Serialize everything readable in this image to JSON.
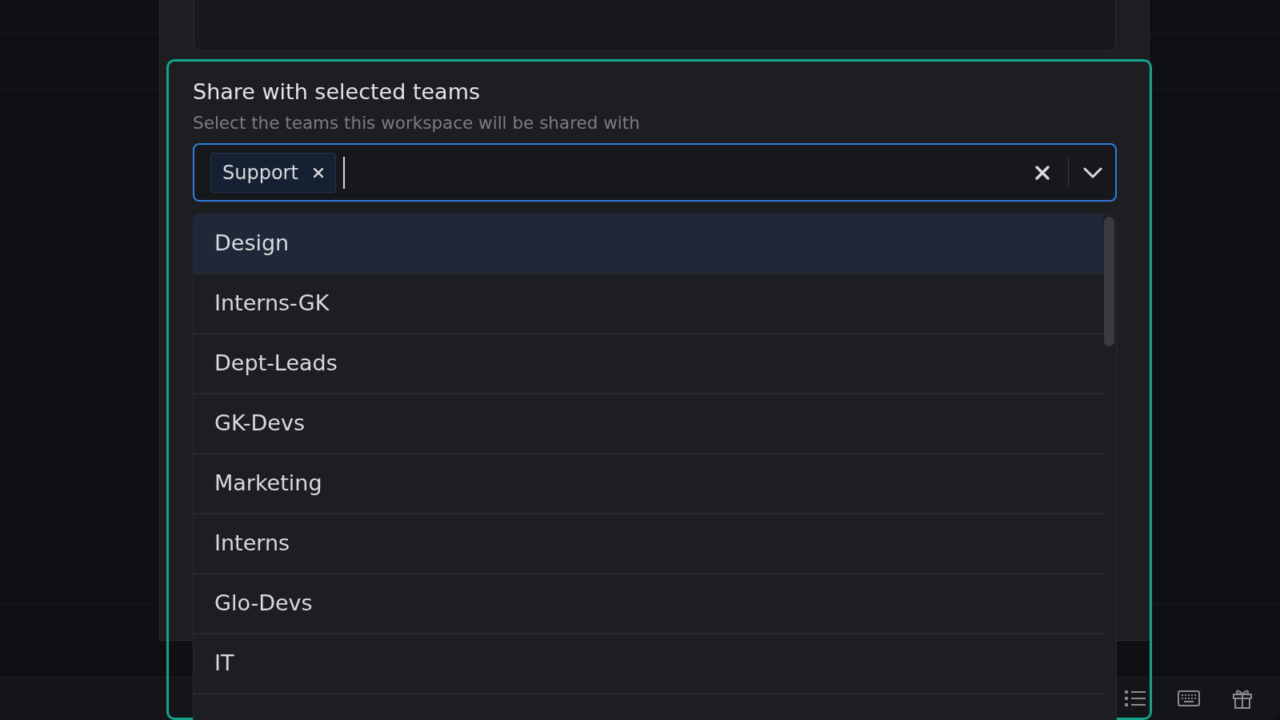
{
  "share_section": {
    "title": "Share with selected teams",
    "description": "Select the teams this workspace will be shared with",
    "select": {
      "chips": [
        {
          "label": "Support"
        }
      ]
    },
    "options": [
      {
        "label": "Design",
        "selected": true
      },
      {
        "label": "Interns-GK",
        "selected": false
      },
      {
        "label": "Dept-Leads",
        "selected": false
      },
      {
        "label": "GK-Devs",
        "selected": false
      },
      {
        "label": "Marketing",
        "selected": false
      },
      {
        "label": "Interns",
        "selected": false
      },
      {
        "label": "Glo-Devs",
        "selected": false
      },
      {
        "label": "IT",
        "selected": false
      }
    ]
  }
}
